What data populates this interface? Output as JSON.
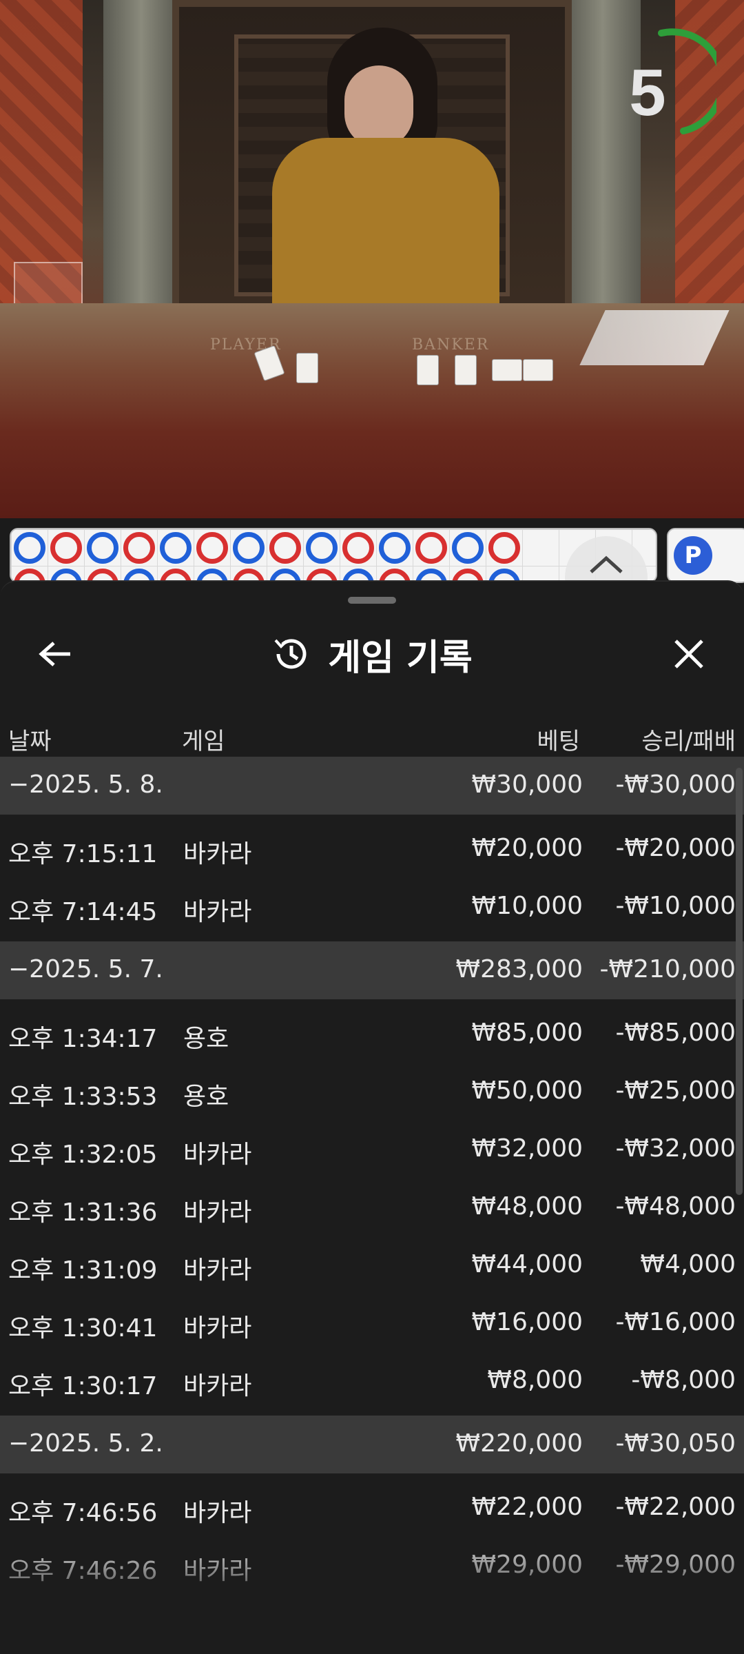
{
  "video": {
    "timer_value": "5",
    "felt_player": "PLAYER",
    "felt_banker": "BANKER"
  },
  "roadmap": {
    "top_row": [
      "P",
      "B",
      "P",
      "B",
      "P",
      "B",
      "P",
      "B",
      "P",
      "B",
      "P",
      "B",
      "P",
      "B"
    ],
    "badge": "P"
  },
  "sheet": {
    "title": "게임 기록",
    "columns": {
      "date": "날짜",
      "game": "게임",
      "bet": "베팅",
      "result": "승리/패배"
    },
    "groups": [
      {
        "date": "−2025. 5. 8.",
        "bet": "₩30,000",
        "result": "-₩30,000",
        "rows": [
          {
            "time": "오후 7:15:11",
            "game": "바카라",
            "bet": "₩20,000",
            "result": "-₩20,000"
          },
          {
            "time": "오후 7:14:45",
            "game": "바카라",
            "bet": "₩10,000",
            "result": "-₩10,000"
          }
        ]
      },
      {
        "date": "−2025. 5. 7.",
        "bet": "₩283,000",
        "result": "-₩210,000",
        "rows": [
          {
            "time": "오후 1:34:17",
            "game": "용호",
            "bet": "₩85,000",
            "result": "-₩85,000"
          },
          {
            "time": "오후 1:33:53",
            "game": "용호",
            "bet": "₩50,000",
            "result": "-₩25,000"
          },
          {
            "time": "오후 1:32:05",
            "game": "바카라",
            "bet": "₩32,000",
            "result": "-₩32,000"
          },
          {
            "time": "오후 1:31:36",
            "game": "바카라",
            "bet": "₩48,000",
            "result": "-₩48,000"
          },
          {
            "time": "오후 1:31:09",
            "game": "바카라",
            "bet": "₩44,000",
            "result": "₩4,000"
          },
          {
            "time": "오후 1:30:41",
            "game": "바카라",
            "bet": "₩16,000",
            "result": "-₩16,000"
          },
          {
            "time": "오후 1:30:17",
            "game": "바카라",
            "bet": "₩8,000",
            "result": "-₩8,000"
          }
        ]
      },
      {
        "date": "−2025. 5. 2.",
        "bet": "₩220,000",
        "result": "-₩30,050",
        "rows": [
          {
            "time": "오후 7:46:56",
            "game": "바카라",
            "bet": "₩22,000",
            "result": "-₩22,000"
          },
          {
            "time": "오후 7:46:26",
            "game": "바카라",
            "bet": "₩29,000",
            "result": "-₩29,000"
          }
        ]
      }
    ]
  },
  "colors": {
    "sheet_bg": "#1c1c1c",
    "group_row_bg": "#3a3a3a",
    "text": "#e9e9e9",
    "timer_arc": "#2e9e3a",
    "player_blue": "#2060d8",
    "banker_red": "#d83030"
  },
  "icons": {
    "back": "arrow-left-icon",
    "history": "history-clock-icon",
    "close": "close-x-icon"
  }
}
